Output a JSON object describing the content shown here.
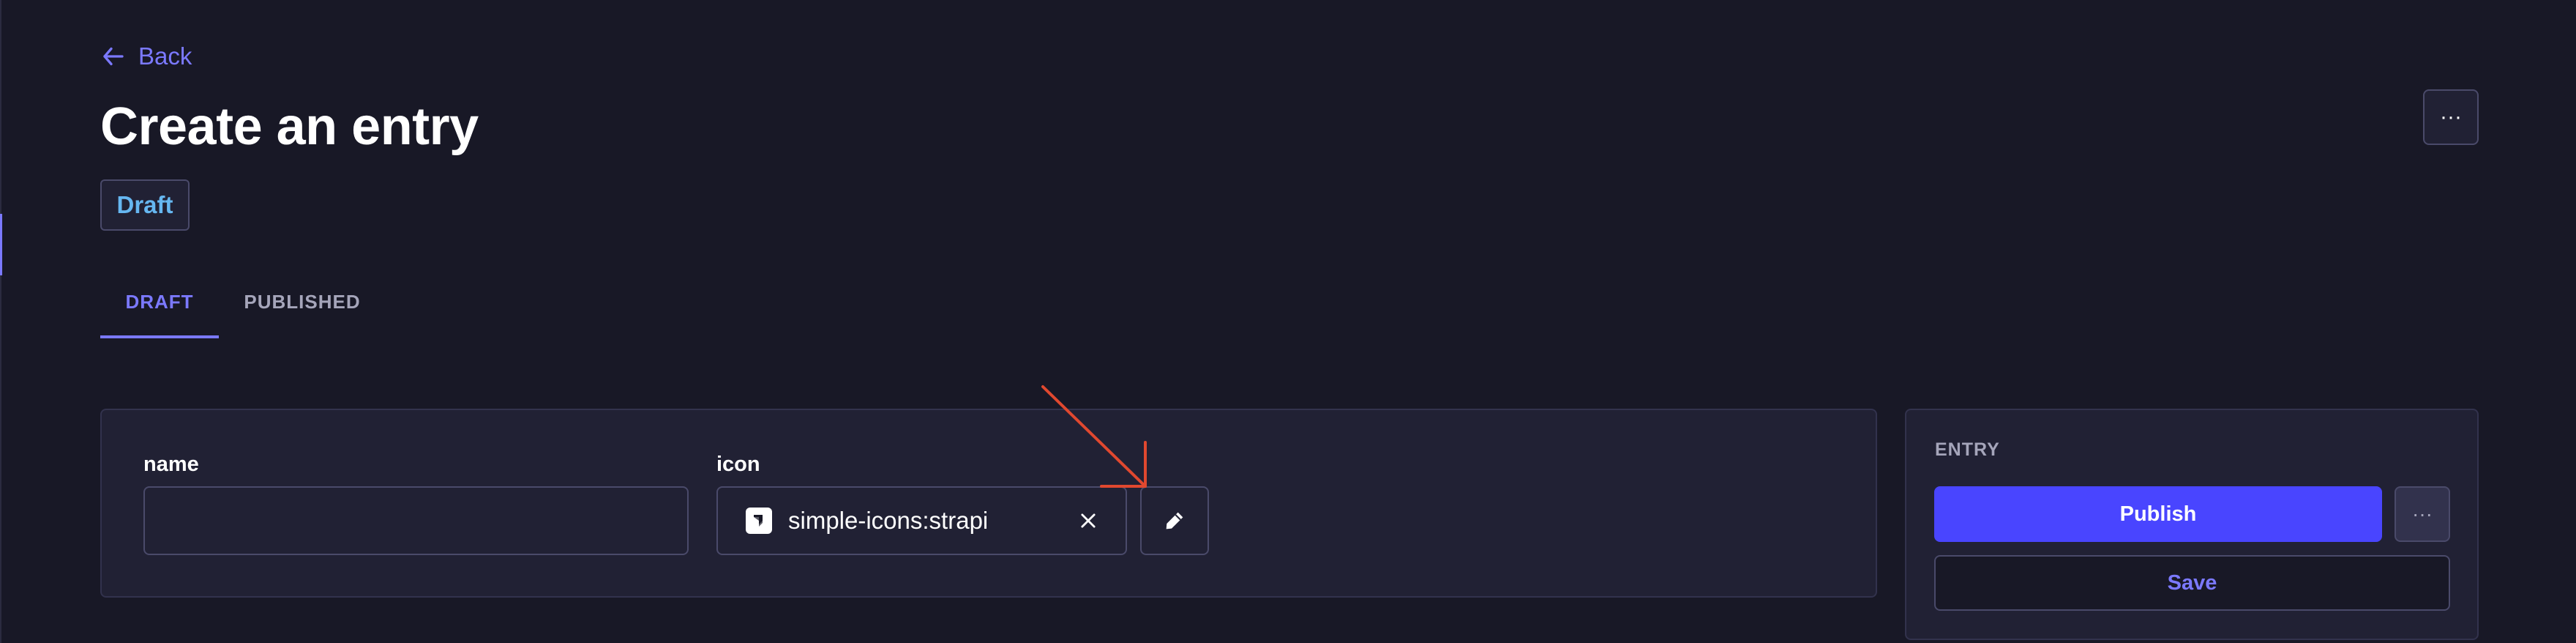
{
  "header": {
    "back_label": "Back",
    "title": "Create an entry",
    "status_badge": "Draft",
    "more_label": "···"
  },
  "tabs": [
    {
      "label": "DRAFT",
      "active": true
    },
    {
      "label": "PUBLISHED",
      "active": false
    }
  ],
  "form": {
    "name_label": "name",
    "name_value": "",
    "icon_label": "icon",
    "icon_value": "simple-icons:strapi"
  },
  "side_panel": {
    "title": "ENTRY",
    "publish_label": "Publish",
    "more_label": "···",
    "save_label": "Save"
  },
  "colors": {
    "background": "#181826",
    "surface": "#212134",
    "accent": "#7b79ff",
    "primary_button": "#4945ff",
    "badge_text": "#66b7f1",
    "annotation_arrow": "#e0482f"
  },
  "icons": {
    "back": "arrow-left-icon",
    "icon_preview": "strapi-logo-icon",
    "clear": "close-icon",
    "edit": "pencil-icon",
    "more": "ellipsis-icon",
    "annotation": "annotation-arrow"
  }
}
